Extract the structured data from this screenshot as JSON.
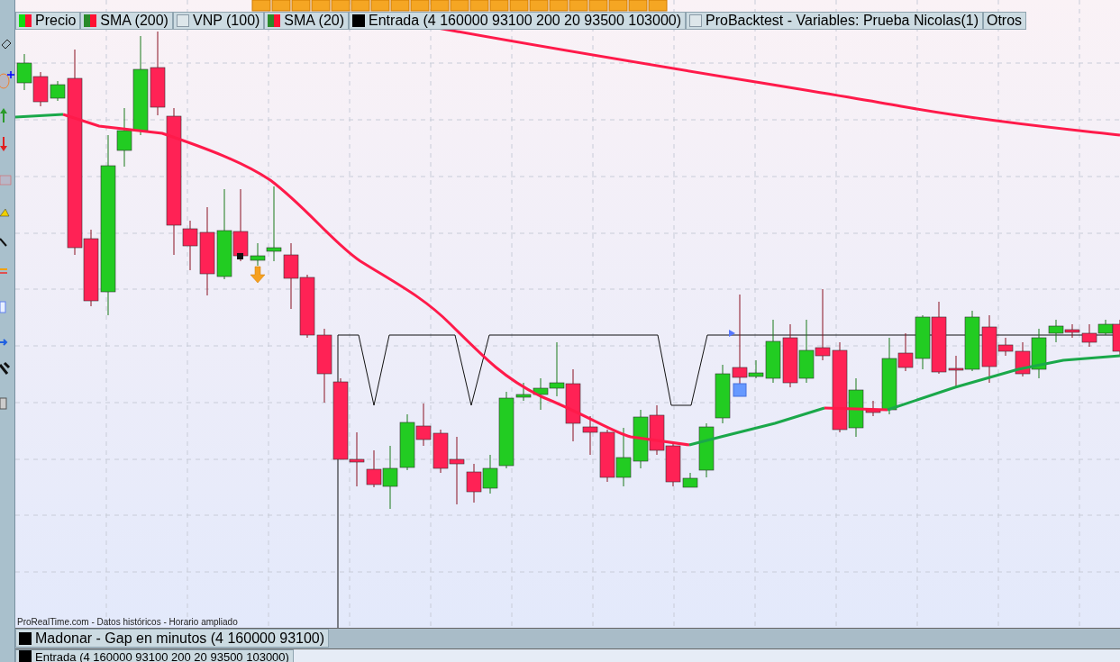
{
  "legend": [
    {
      "label": "Precio",
      "kind": "updown"
    },
    {
      "label": "SMA (200)",
      "kind": "updowndark"
    },
    {
      "label": "VNP (100)",
      "kind": "empty"
    },
    {
      "label": "SMA (20)",
      "kind": "updowndark"
    },
    {
      "label": "Entrada (4 160000 93100 200 20 93500 103000)",
      "kind": "solid"
    },
    {
      "label": "ProBacktest - Variables: Prueba Nicolas(1)",
      "kind": "empty"
    },
    {
      "label": "Otros",
      "kind": "plain"
    }
  ],
  "source_note": "ProRealTime.com - Datos históricos - Horario ampliado",
  "panels": [
    {
      "label": "Madonar - Gap en minutos (4 160000 93100)",
      "kind": "solid"
    },
    {
      "label": "Entrada (4 160000 93100 200 20 93500 103000)",
      "kind": "solid"
    }
  ]
}
